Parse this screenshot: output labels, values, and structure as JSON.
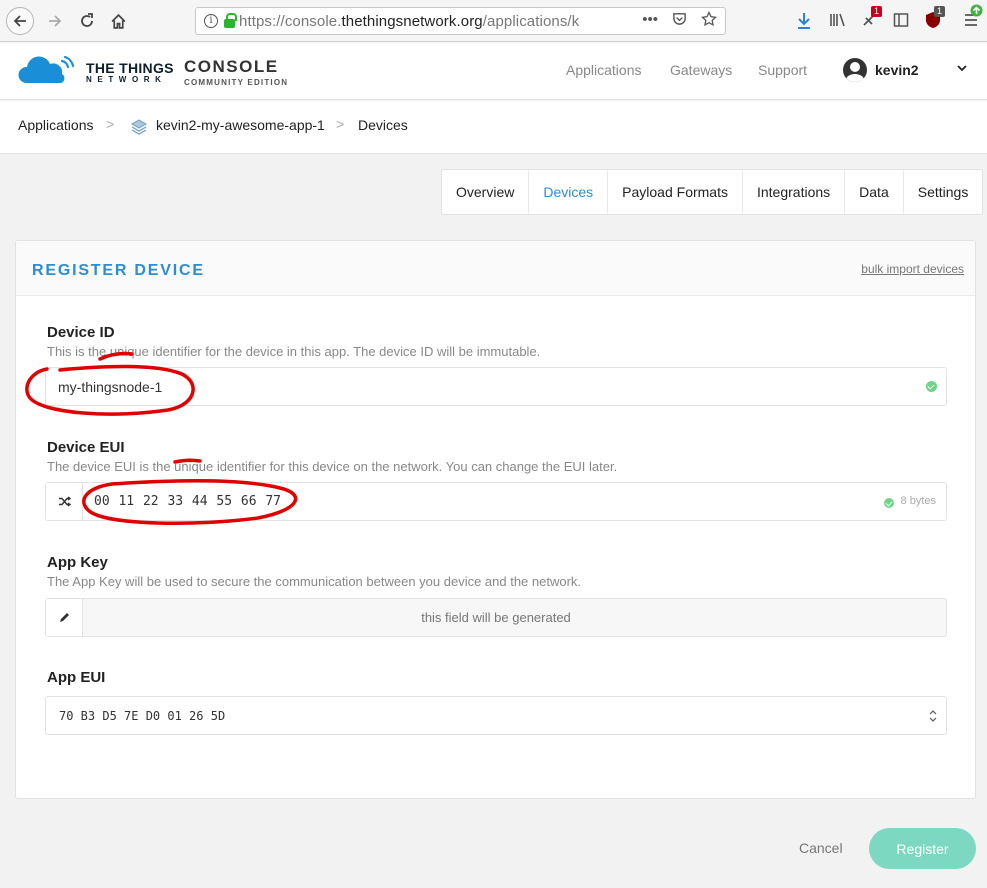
{
  "browser": {
    "url_prefix": "https://console.",
    "url_domain": "thethingsnetwork.org",
    "url_path": "/applications/k",
    "more_actions": "•••",
    "badge_red": "1",
    "badge_grey": "1"
  },
  "header": {
    "logo_line1": "THE THINGS",
    "logo_line2": "NETWORK",
    "console": "CONSOLE",
    "edition": "COMMUNITY EDITION",
    "nav": [
      "Applications",
      "Gateways",
      "Support"
    ],
    "username": "kevin2"
  },
  "breadcrumb": {
    "items": [
      "Applications",
      "kevin2-my-awesome-app-1",
      "Devices"
    ],
    "separator": ">"
  },
  "tabs": [
    {
      "label": "Overview",
      "active": false
    },
    {
      "label": "Devices",
      "active": true
    },
    {
      "label": "Payload Formats",
      "active": false
    },
    {
      "label": "Integrations",
      "active": false
    },
    {
      "label": "Data",
      "active": false
    },
    {
      "label": "Settings",
      "active": false
    }
  ],
  "form": {
    "title": "REGISTER DEVICE",
    "bulk_import": "bulk import devices",
    "device_id": {
      "label": "Device ID",
      "description": "This is the unique identifier for the device in this app. The device ID will be immutable.",
      "value": "my-thingsnode-1"
    },
    "device_eui": {
      "label": "Device EUI",
      "description": "The device EUI is the unique identifier for this device on the network. You can change the EUI later.",
      "value": "00 11 22 33 44 55 66 77",
      "hint": "8 bytes"
    },
    "app_key": {
      "label": "App Key",
      "description": "The App Key will be used to secure the communication between you device and the network.",
      "placeholder": "this field will be generated"
    },
    "app_eui": {
      "label": "App EUI",
      "value": "70 B3 D5 7E D0 01 26 5D"
    }
  },
  "actions": {
    "cancel": "Cancel",
    "register": "Register"
  },
  "colors": {
    "accent": "#2d8dd0",
    "register_button": "#7dd8c2",
    "ok": "#6cd686",
    "annotation": "#e00000"
  }
}
